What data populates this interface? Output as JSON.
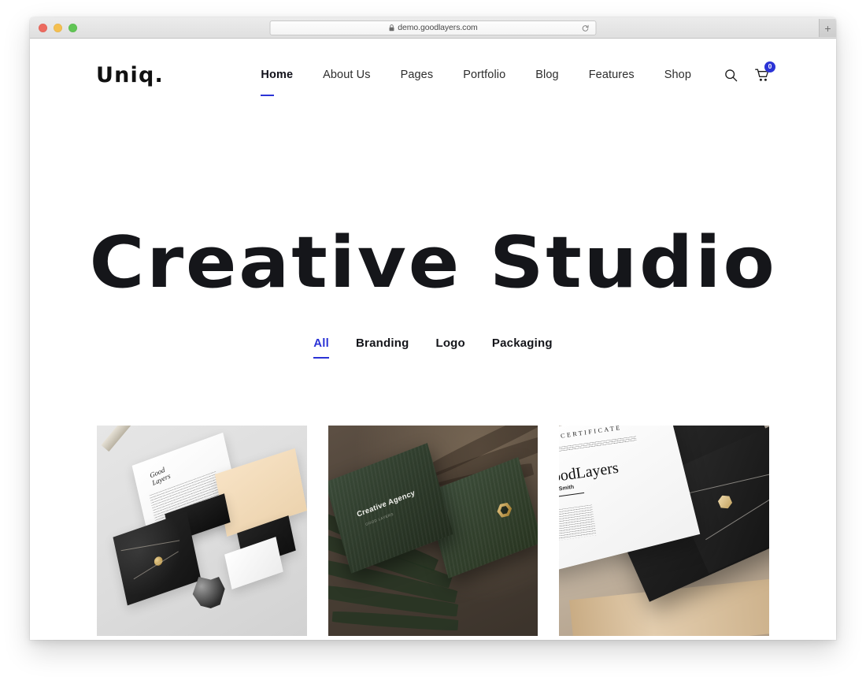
{
  "browser": {
    "url": "demo.goodlayers.com",
    "lock_icon": "lock-icon",
    "reload_icon": "reload-icon",
    "new_tab_label": "+",
    "traffic_lights": [
      "close",
      "minimize",
      "maximize"
    ]
  },
  "site": {
    "logo": "Uniq.",
    "nav": [
      {
        "label": "Home",
        "active": true
      },
      {
        "label": "About Us",
        "active": false
      },
      {
        "label": "Pages",
        "active": false
      },
      {
        "label": "Portfolio",
        "active": false
      },
      {
        "label": "Blog",
        "active": false
      },
      {
        "label": "Features",
        "active": false
      },
      {
        "label": "Shop",
        "active": false
      }
    ],
    "tools": {
      "search_icon": "search-icon",
      "cart_icon": "cart-icon",
      "cart_count": "0"
    },
    "hero": {
      "title": "Creative Studio"
    },
    "filters": [
      {
        "label": "All",
        "active": true
      },
      {
        "label": "Branding",
        "active": false
      },
      {
        "label": "Logo",
        "active": false
      },
      {
        "label": "Packaging",
        "active": false
      }
    ],
    "portfolio": {
      "items": [
        {
          "art": "stationery-mockup",
          "brand_line_1": "Good",
          "brand_line_2": "Layers"
        },
        {
          "art": "green-business-cards-on-palm",
          "card_title": "Creative Agency",
          "card_subtitle": "GOOD LAYERS"
        },
        {
          "art": "certificate-on-marble",
          "kicker": "CERTIFICATE",
          "brand": "GoodLayers",
          "name": "John Smith"
        }
      ],
      "next_row": [
        {
          "art": "navy-tile"
        },
        {
          "art": "white-tile"
        },
        {
          "art": "wood-tile"
        }
      ]
    }
  },
  "colors": {
    "accent": "#2b33d6",
    "text": "#15161a",
    "page_bg": "#ffffff"
  }
}
